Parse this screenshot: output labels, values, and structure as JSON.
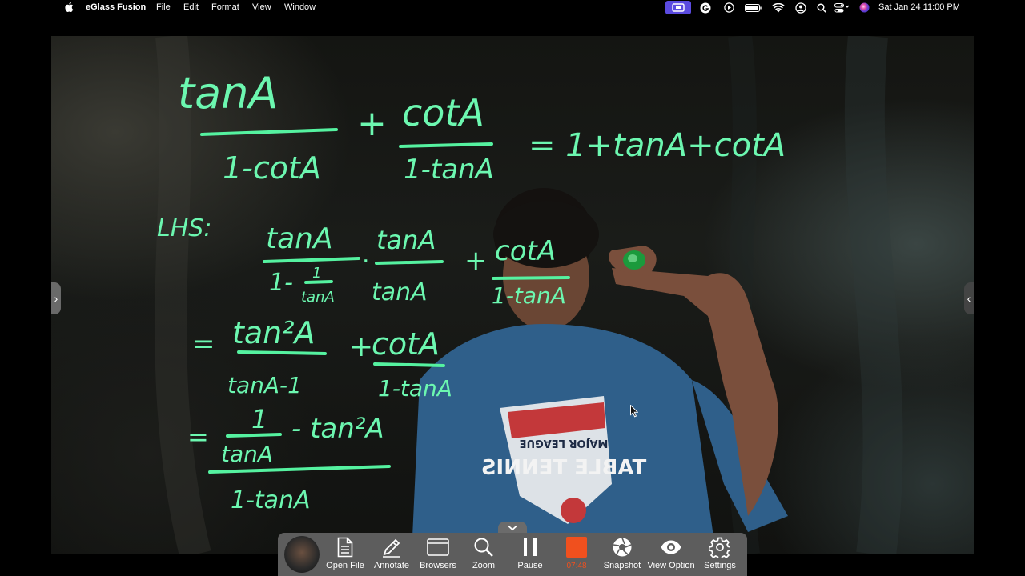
{
  "menubar": {
    "app_name": "eGlass Fusion",
    "menus": [
      "File",
      "Edit",
      "Format",
      "View",
      "Window"
    ],
    "clock": "Sat Jan 24  11:00 PM",
    "status_icons": [
      "screen-record-icon",
      "grammarly-icon",
      "play-icon",
      "battery-icon",
      "wifi-icon",
      "user-icon",
      "search-icon",
      "control-center-icon",
      "siri-icon"
    ],
    "accent_color": "#5b4be0"
  },
  "board": {
    "ink_color": "#55f2a0",
    "line1_num1": "tanA",
    "line1_den1": "1-cotA",
    "line1_num2": "cotA",
    "line1_den2": "1-tanA",
    "line1_rhs": "= 1+tanA+cotA",
    "lhs_label": "LHS:",
    "l2_num1": "tanA",
    "l2_den1a": "1-",
    "l2_den1_frac_num": "1",
    "l2_den1_frac_den": "tanA",
    "l2_mult_num": "tanA",
    "l2_mult_den": "tanA",
    "l2_num2": "cotA",
    "l2_den2": "1-tanA",
    "l3_eq": "=",
    "l3_num1": "tan²A",
    "l3_den1": "tanA-1",
    "l3_num2": "cotA",
    "l3_den2": "1-tanA",
    "l4_eq": "=",
    "l4_frac_num": "1",
    "l4_frac_den": "tanA",
    "l4_rest": "- tan²A",
    "l4_den": "1-tanA",
    "shirt_line1": "MAJOR LEAGUE",
    "shirt_line2": "TABLE TENNIS"
  },
  "toolbar": {
    "collapse_icon": "chevron-down-icon",
    "items": [
      {
        "label": "Open File",
        "icon": "document-icon"
      },
      {
        "label": "Annotate",
        "icon": "pen-icon"
      },
      {
        "label": "Browsers",
        "icon": "browser-window-icon"
      },
      {
        "label": "Zoom",
        "icon": "magnifier-icon"
      },
      {
        "label": "Pause",
        "icon": "pause-icon"
      },
      {
        "label": "07:48",
        "icon": "record-stop-icon"
      },
      {
        "label": "Snapshot",
        "icon": "aperture-icon"
      },
      {
        "label": "View Option",
        "icon": "eye-icon"
      },
      {
        "label": "Settings",
        "icon": "gear-icon"
      }
    ],
    "record_color": "#f0501e"
  }
}
